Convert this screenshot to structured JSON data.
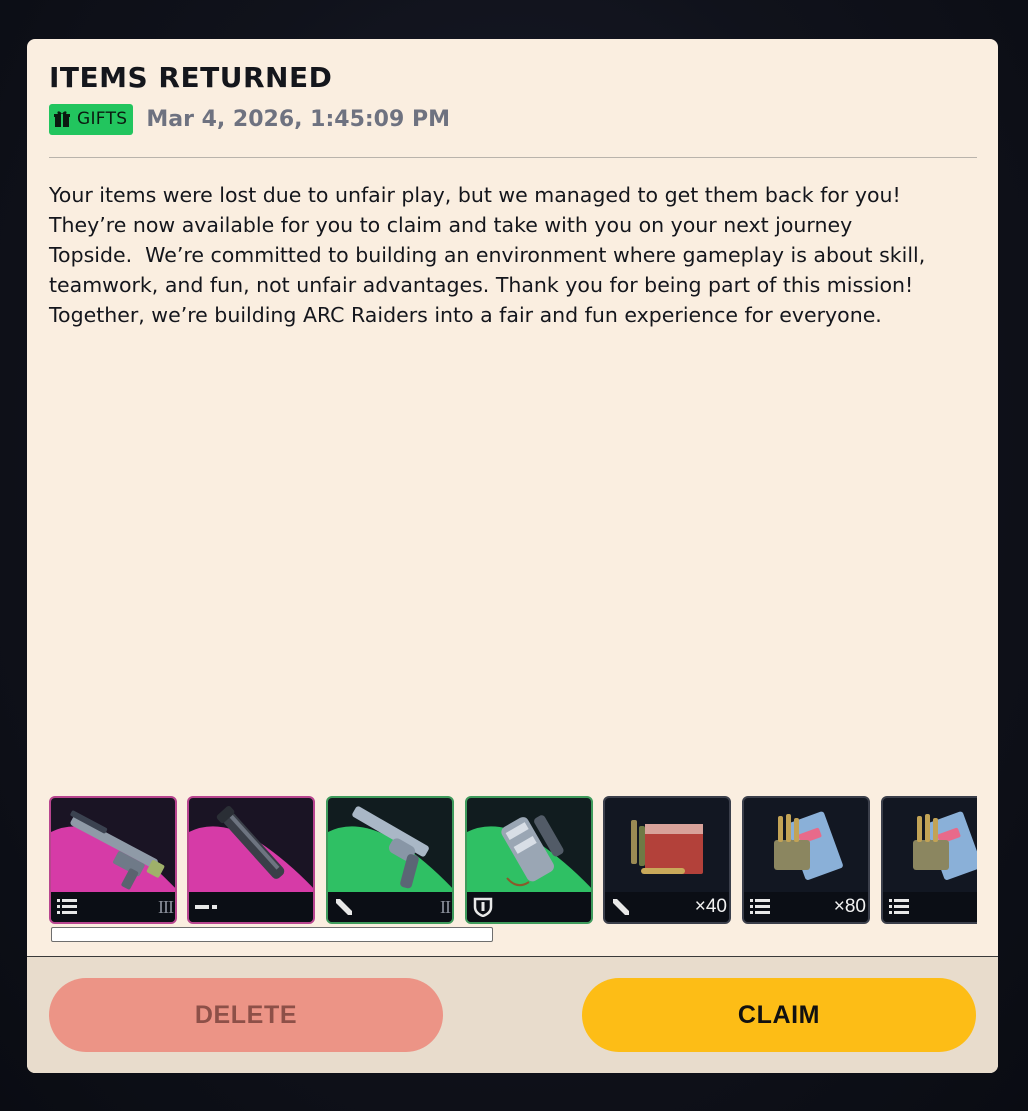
{
  "dialog": {
    "title": "ITEMS RETURNED",
    "badge_label": "GIFTS",
    "date": "Mar 4, 2026, 1:45:09 PM",
    "message_lines": [
      "Your items were lost due to unfair play, but we managed to get them back for you!",
      "They’re now available for you to claim and take with you on your next journey",
      "Topside.  We’re committed to building an environment where gameplay is about skill,",
      "teamwork, and fun, not unfair advantages. Thank you for being part of this mission!",
      "Together, we’re building ARC Raiders into a fair and fun experience for everyone."
    ]
  },
  "items": [
    {
      "rarity": "epic",
      "type_icon": "list-icon",
      "tier": "III",
      "quantity": ""
    },
    {
      "rarity": "epic",
      "type_icon": "dash-icon",
      "tier": "",
      "quantity": ""
    },
    {
      "rarity": "uncommon",
      "type_icon": "pencil-icon",
      "tier": "II",
      "quantity": ""
    },
    {
      "rarity": "uncommon",
      "type_icon": "shield-icon",
      "tier": "",
      "quantity": ""
    },
    {
      "rarity": "common",
      "type_icon": "pencil-icon",
      "tier": "",
      "quantity": "×40"
    },
    {
      "rarity": "common",
      "type_icon": "list-icon",
      "tier": "",
      "quantity": "×80"
    },
    {
      "rarity": "common",
      "type_icon": "list-icon",
      "tier": "",
      "quantity": "×"
    }
  ],
  "actions": {
    "delete_label": "DELETE",
    "claim_label": "CLAIM"
  },
  "colors": {
    "panel_bg": "#faeee0",
    "gifts_badge": "#22c55e",
    "epic": "#d63ba7",
    "uncommon": "#2fc064",
    "claim": "#fdbd16",
    "delete": "#ec9486"
  }
}
